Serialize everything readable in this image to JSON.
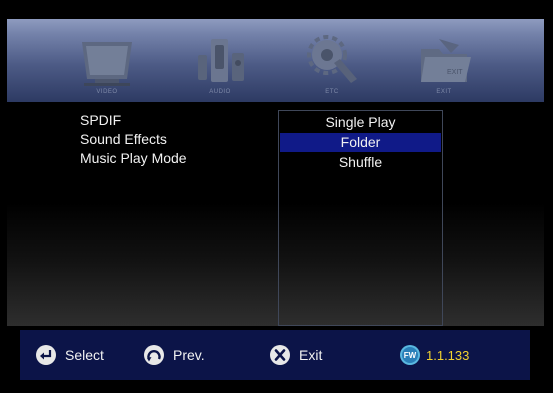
{
  "top_menu": {
    "tabs": [
      {
        "label": "VIDEO",
        "icon": "tv-icon"
      },
      {
        "label": "AUDIO",
        "icon": "speaker-icon"
      },
      {
        "label": "ETC",
        "icon": "settings-wrench-icon"
      },
      {
        "label": "EXIT",
        "icon": "exit-folder-icon"
      }
    ]
  },
  "settings_menu": {
    "items": [
      "SPDIF",
      "Sound Effects",
      "Music Play Mode"
    ]
  },
  "options": {
    "items": [
      "Single Play",
      "Folder",
      "Shuffle"
    ],
    "selected": "Folder"
  },
  "footer": {
    "select_label": "Select",
    "prev_label": "Prev.",
    "exit_label": "Exit",
    "fw_badge": "FW",
    "fw_version": "1.1.133"
  },
  "colors": {
    "highlight": "#101a88",
    "footer_bg": "#0c1448",
    "fw_version_text": "#f2d230"
  }
}
